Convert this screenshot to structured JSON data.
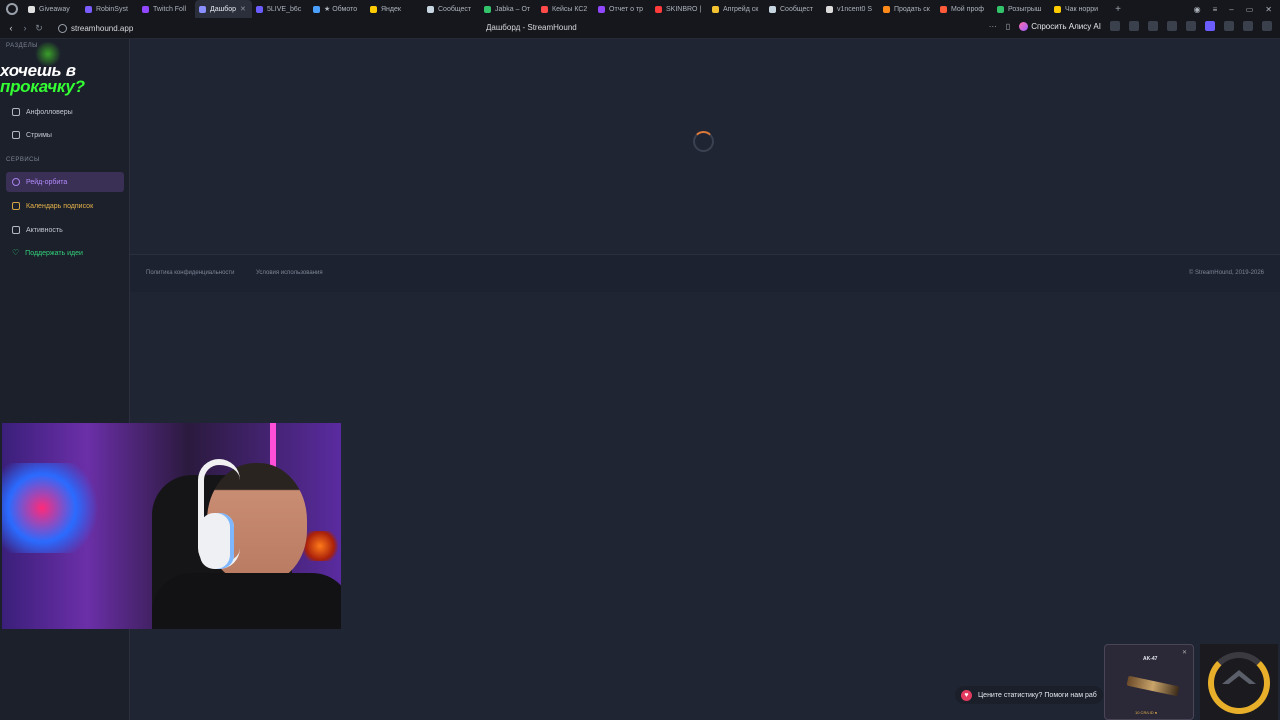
{
  "browser": {
    "tabs": [
      {
        "label": "Giveaway",
        "color": "#e0e0e0"
      },
      {
        "label": "RobinSyst",
        "color": "#7a5cff"
      },
      {
        "label": "Twitch Foll",
        "color": "#9146ff"
      },
      {
        "label": "Дашбор",
        "color": "#8a8fff",
        "active": true
      },
      {
        "label": "5LIVE_b6c",
        "color": "#6a5cff"
      },
      {
        "label": "★ Обмото",
        "color": "#4a9fff"
      },
      {
        "label": "Яндек",
        "color": "#ffcc00"
      },
      {
        "label": "Сообщест",
        "color": "#c7d5e0"
      },
      {
        "label": "Jabka – От",
        "color": "#33c36b"
      },
      {
        "label": "Кейсы КС2",
        "color": "#ff4a4a"
      },
      {
        "label": "Отчет о тр",
        "color": "#9146ff"
      },
      {
        "label": "SKINBRO |",
        "color": "#ff3b3b"
      },
      {
        "label": "Апгрейд ск",
        "color": "#f2c230"
      },
      {
        "label": "Сообщест",
        "color": "#c7d5e0"
      },
      {
        "label": "v1ncent0 S",
        "color": "#dcdcdc"
      },
      {
        "label": "Продать ск",
        "color": "#ff8a1a"
      },
      {
        "label": "Мой проф",
        "color": "#ff5a3a"
      },
      {
        "label": "Розыгрыш",
        "color": "#33c36b"
      },
      {
        "label": "Чак норри",
        "color": "#ffcc00"
      }
    ],
    "url": "streamhound.app",
    "page_title": "Дашборд - StreamHound",
    "alice_label": "Спросить Алису AI"
  },
  "sidebar": {
    "section_sections": "РАЗДЕЛЫ",
    "section_services": "СЕРВИСЫ",
    "items": [
      {
        "label": "Анфолловеры"
      },
      {
        "label": "Стримы"
      }
    ],
    "services": [
      {
        "label": "Рейд-орбита",
        "state": "active"
      },
      {
        "label": "Календарь подписок",
        "state": "gold"
      },
      {
        "label": "Активность"
      },
      {
        "label": "Поддержать идеи",
        "state": "green"
      }
    ]
  },
  "promo": {
    "line1": "хочешь в",
    "line2": "прокачку?"
  },
  "footer": {
    "privacy": "Политика конфиденциальности",
    "terms": "Условия использования",
    "copyright": "© StreamHound, 2019-2026"
  },
  "toast": {
    "text": "Цените статистику? Помоги нам раб"
  },
  "skin_card": {
    "name": "AK-47",
    "price": "10 CR/LID ●"
  },
  "colors": {
    "accent": "#b48cff",
    "gold": "#e7b34a",
    "green": "#33d17a",
    "spinner": "#e07a3a"
  }
}
